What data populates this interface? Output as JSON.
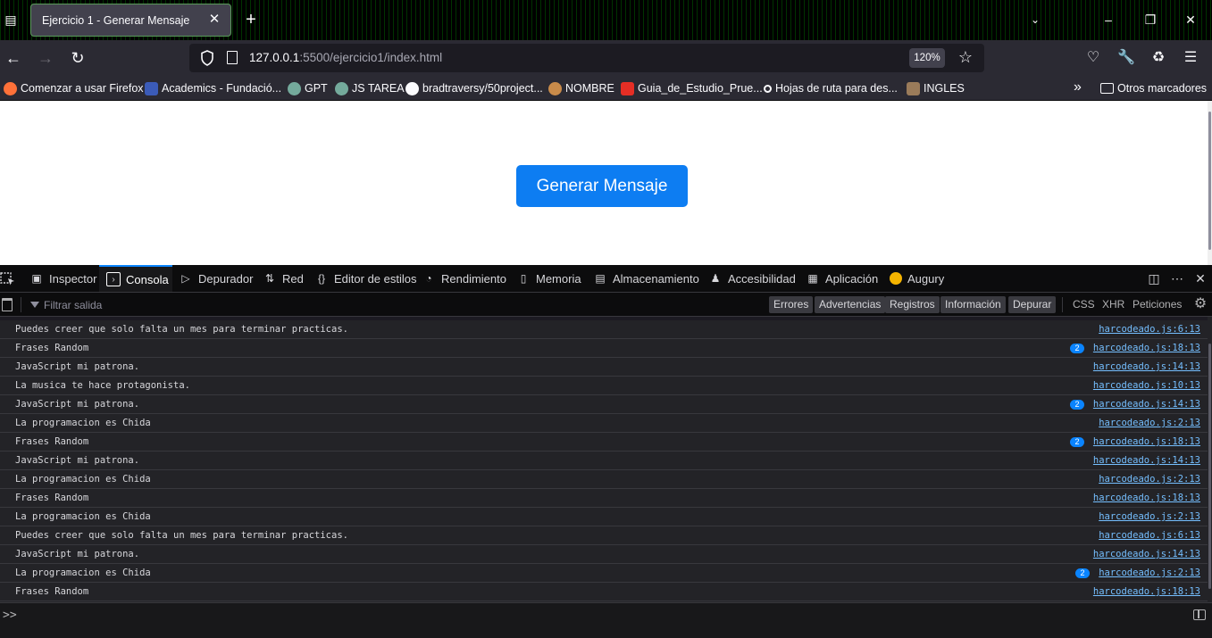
{
  "browser": {
    "tab": {
      "title": "Ejercicio 1 - Generar Mensaje"
    },
    "url": {
      "host": "127.0.0.1",
      "path": ":5500/ejercicio1/index.html"
    },
    "zoom": "120%"
  },
  "bookmarks": {
    "items": [
      {
        "label": "Comenzar a usar Firefox",
        "icon": "firefox-icon",
        "color": "#ff7139"
      },
      {
        "label": "Academics - Fundació...",
        "icon": "academics-icon",
        "color": "#3b5bb8"
      },
      {
        "label": "GPT",
        "icon": "chatgpt-icon",
        "color": "#74aa9c"
      },
      {
        "label": "JS TAREA",
        "icon": "chatgpt-icon",
        "color": "#74aa9c"
      },
      {
        "label": "bradtraversy/50project...",
        "icon": "github-icon",
        "color": "#fbfbfe"
      },
      {
        "label": "NOMBRE",
        "icon": "coffee-icon",
        "color": "#c98b4a"
      },
      {
        "label": "Guia_de_Estudio_Prue...",
        "icon": "pdf-icon",
        "color": "#e52e25"
      },
      {
        "label": "Hojas de ruta para des...",
        "icon": "roadmap-icon",
        "color": "#fbfbfe"
      },
      {
        "label": "INGLES",
        "icon": "unam-icon",
        "color": "#9a7b5a"
      }
    ],
    "other": "Otros marcadores"
  },
  "page": {
    "button_label": "Generar Mensaje"
  },
  "devtools": {
    "tabs": [
      {
        "label": "Inspector",
        "icon": "inspector-icon"
      },
      {
        "label": "Consola",
        "icon": "console-icon",
        "active": true
      },
      {
        "label": "Depurador",
        "icon": "debugger-icon"
      },
      {
        "label": "Red",
        "icon": "network-icon"
      },
      {
        "label": "Editor de estilos",
        "icon": "style-editor-icon"
      },
      {
        "label": "Rendimiento",
        "icon": "performance-icon"
      },
      {
        "label": "Memoria",
        "icon": "memory-icon"
      },
      {
        "label": "Almacenamiento",
        "icon": "storage-icon"
      },
      {
        "label": "Accesibilidad",
        "icon": "accessibility-icon"
      },
      {
        "label": "Aplicación",
        "icon": "application-icon"
      },
      {
        "label": "Augury",
        "icon": "augury-icon"
      }
    ],
    "filter_placeholder": "Filtrar salida",
    "levels": [
      "Errores",
      "Advertencias",
      "Registros",
      "Información",
      "Depurar"
    ],
    "net_filters": [
      "CSS",
      "XHR",
      "Peticiones"
    ],
    "prompt": ">>",
    "messages": [
      {
        "text": "Puedes creer que solo falta un mes para terminar practicas.",
        "loc": "harcodeado.js:6:13",
        "count": null
      },
      {
        "text": "Frases Random",
        "loc": "harcodeado.js:18:13",
        "count": "2"
      },
      {
        "text": "JavaScript mi patrona.",
        "loc": "harcodeado.js:14:13",
        "count": null
      },
      {
        "text": "La musica te hace protagonista.",
        "loc": "harcodeado.js:10:13",
        "count": null
      },
      {
        "text": "JavaScript mi patrona.",
        "loc": "harcodeado.js:14:13",
        "count": "2"
      },
      {
        "text": "La programacion es Chida",
        "loc": "harcodeado.js:2:13",
        "count": null
      },
      {
        "text": "Frases Random",
        "loc": "harcodeado.js:18:13",
        "count": "2"
      },
      {
        "text": "JavaScript mi patrona.",
        "loc": "harcodeado.js:14:13",
        "count": null
      },
      {
        "text": "La programacion es Chida",
        "loc": "harcodeado.js:2:13",
        "count": null
      },
      {
        "text": "Frases Random",
        "loc": "harcodeado.js:18:13",
        "count": null
      },
      {
        "text": "La programacion es Chida",
        "loc": "harcodeado.js:2:13",
        "count": null
      },
      {
        "text": "Puedes creer que solo falta un mes para terminar practicas.",
        "loc": "harcodeado.js:6:13",
        "count": null
      },
      {
        "text": "JavaScript mi patrona.",
        "loc": "harcodeado.js:14:13",
        "count": null
      },
      {
        "text": "La programacion es Chida",
        "loc": "harcodeado.js:2:13",
        "count": "2"
      },
      {
        "text": "Frases Random",
        "loc": "harcodeado.js:18:13",
        "count": null
      }
    ]
  }
}
